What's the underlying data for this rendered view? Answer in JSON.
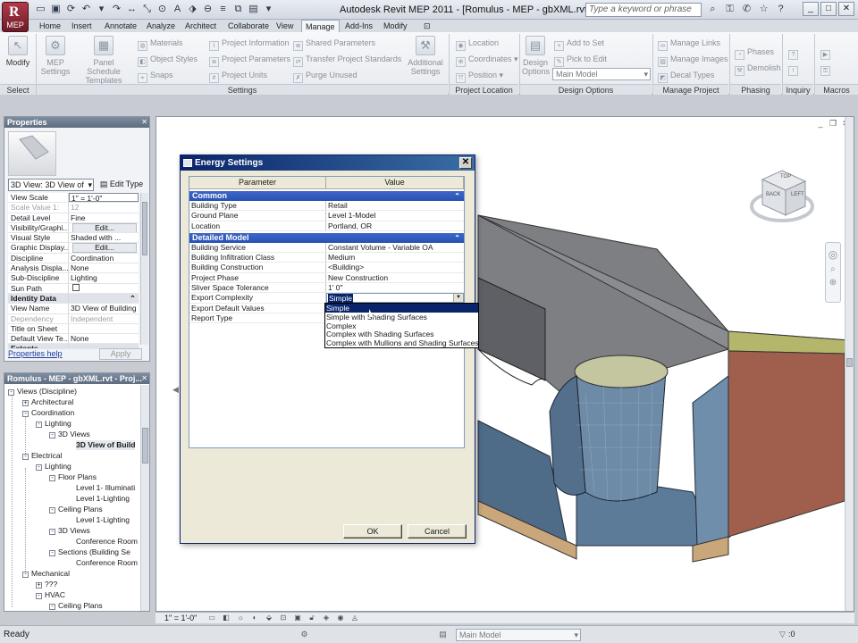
{
  "app": {
    "button_label": "MEP",
    "title": "Autodesk Revit MEP 2011 - [Romulus - MEP - gbXML.rvt - 3...",
    "search_placeholder": "Type a keyword or phrase"
  },
  "tabs": [
    "Home",
    "Insert",
    "Annotate",
    "Analyze",
    "Architect",
    "Collaborate",
    "View",
    "Manage",
    "Add-Ins",
    "Modify"
  ],
  "active_tab": "Manage",
  "ribbon": {
    "modify": "Modify",
    "mep_settings": "MEP Settings",
    "panel_schedule_templates": "Panel Schedule Templates",
    "materials": "Materials",
    "object_styles": "Object Styles",
    "snaps": "Snaps",
    "project_information": "Project Information",
    "project_parameters": "Project Parameters",
    "project_units": "Project Units",
    "shared_parameters": "Shared Parameters",
    "transfer_project_standards": "Transfer Project Standards",
    "purge_unused": "Purge Unused",
    "additional_settings": "Additional Settings",
    "location": "Location",
    "coordinates": "Coordinates",
    "position": "Position",
    "design_options": "Design Options",
    "add_to_set": "Add to Set",
    "pick_to_edit": "Pick to Edit",
    "main_model": "Main Model",
    "manage_links": "Manage Links",
    "manage_images": "Manage Images",
    "decal_types": "Decal Types",
    "phases": "Phases",
    "demolish": "Demolish",
    "panels": {
      "select": "Select",
      "settings": "Settings",
      "project_location": "Project Location",
      "design_options": "Design Options",
      "manage_project": "Manage Project",
      "phasing": "Phasing",
      "inquiry": "Inquiry",
      "macros": "Macros"
    }
  },
  "properties": {
    "title": "Properties",
    "type_selector": "3D View: 3D View of",
    "edit_type": "Edit Type",
    "rows": [
      {
        "k": "View Scale",
        "v": "1\" = 1'-0\""
      },
      {
        "k": "Scale Value   1:",
        "v": "12"
      },
      {
        "k": "Detail Level",
        "v": "Fine"
      },
      {
        "k": "Visibility/Graphi...",
        "v": "Edit..."
      },
      {
        "k": "Visual Style",
        "v": "Shaded with ..."
      },
      {
        "k": "Graphic Display...",
        "v": "Edit..."
      },
      {
        "k": "Discipline",
        "v": "Coordination"
      },
      {
        "k": "Analysis Displa...",
        "v": "None"
      },
      {
        "k": "Sub-Discipline",
        "v": "Lighting"
      },
      {
        "k": "Sun Path",
        "v": ""
      },
      {
        "k": "Identity Data",
        "v": ""
      },
      {
        "k": "View Name",
        "v": "3D View of Building"
      },
      {
        "k": "Dependency",
        "v": "Independent"
      },
      {
        "k": "Title on Sheet",
        "v": ""
      },
      {
        "k": "Default View Te...",
        "v": "None"
      },
      {
        "k": "Extents",
        "v": ""
      }
    ],
    "help_link": "Properties help",
    "apply": "Apply"
  },
  "browser": {
    "title": "Romulus - MEP - gbXML.rvt - Proj...",
    "items": [
      {
        "t": "Views (Discipline)",
        "toggle": "-"
      },
      {
        "t": "Architectural",
        "toggle": "+"
      },
      {
        "t": "Coordination",
        "toggle": "-"
      },
      {
        "t": "Lighting",
        "toggle": "-"
      },
      {
        "t": "3D Views",
        "toggle": "-"
      },
      {
        "t": "3D View of Build",
        "toggle": ""
      },
      {
        "t": "Electrical",
        "toggle": "-"
      },
      {
        "t": "Lighting",
        "toggle": "-"
      },
      {
        "t": "Floor Plans",
        "toggle": "-"
      },
      {
        "t": "Level 1- Illuminati",
        "toggle": ""
      },
      {
        "t": "Level 1-Lighting",
        "toggle": ""
      },
      {
        "t": "Ceiling Plans",
        "toggle": "-"
      },
      {
        "t": "Level 1-Lighting",
        "toggle": ""
      },
      {
        "t": "3D Views",
        "toggle": "-"
      },
      {
        "t": "Conference Room",
        "toggle": ""
      },
      {
        "t": "Sections (Building Se",
        "toggle": "-"
      },
      {
        "t": "Conference Room",
        "toggle": ""
      },
      {
        "t": "Mechanical",
        "toggle": "-"
      },
      {
        "t": "???",
        "toggle": "+"
      },
      {
        "t": "HVAC",
        "toggle": "-"
      },
      {
        "t": "Ceiling Plans",
        "toggle": "-"
      }
    ]
  },
  "dialog": {
    "title": "Energy Settings",
    "col_parameter": "Parameter",
    "col_value": "Value",
    "sections": [
      {
        "name": "Common",
        "rows": [
          {
            "k": "Building Type",
            "v": "Retail"
          },
          {
            "k": "Ground Plane",
            "v": "Level 1-Model"
          },
          {
            "k": "Location",
            "v": "Portland, OR"
          }
        ]
      },
      {
        "name": "Detailed Model",
        "rows": [
          {
            "k": "Building Service",
            "v": "Constant Volume - Variable OA"
          },
          {
            "k": "Building Infiltration Class",
            "v": "Medium"
          },
          {
            "k": "Building Construction",
            "v": "<Building>"
          },
          {
            "k": "Project Phase",
            "v": "New Construction"
          },
          {
            "k": "Sliver Space Tolerance",
            "v": "1'  0\""
          },
          {
            "k": "Export Complexity",
            "v": "Simple"
          },
          {
            "k": "Export Default Values",
            "v": ""
          },
          {
            "k": "Report Type",
            "v": ""
          }
        ]
      }
    ],
    "dropdown_options": [
      "Simple",
      "Simple with Shading Surfaces",
      "Complex",
      "Complex with Shading Surfaces",
      "Complex with Mullions and Shading Surfaces"
    ],
    "ok": "OK",
    "cancel": "Cancel"
  },
  "viewcube": {
    "back": "BACK",
    "left": "LEFT",
    "top": "TOP"
  },
  "view_control": {
    "scale": "1\" = 1'-0\""
  },
  "status": {
    "text": "Ready",
    "model": "Main Model",
    "zero": ":0"
  }
}
